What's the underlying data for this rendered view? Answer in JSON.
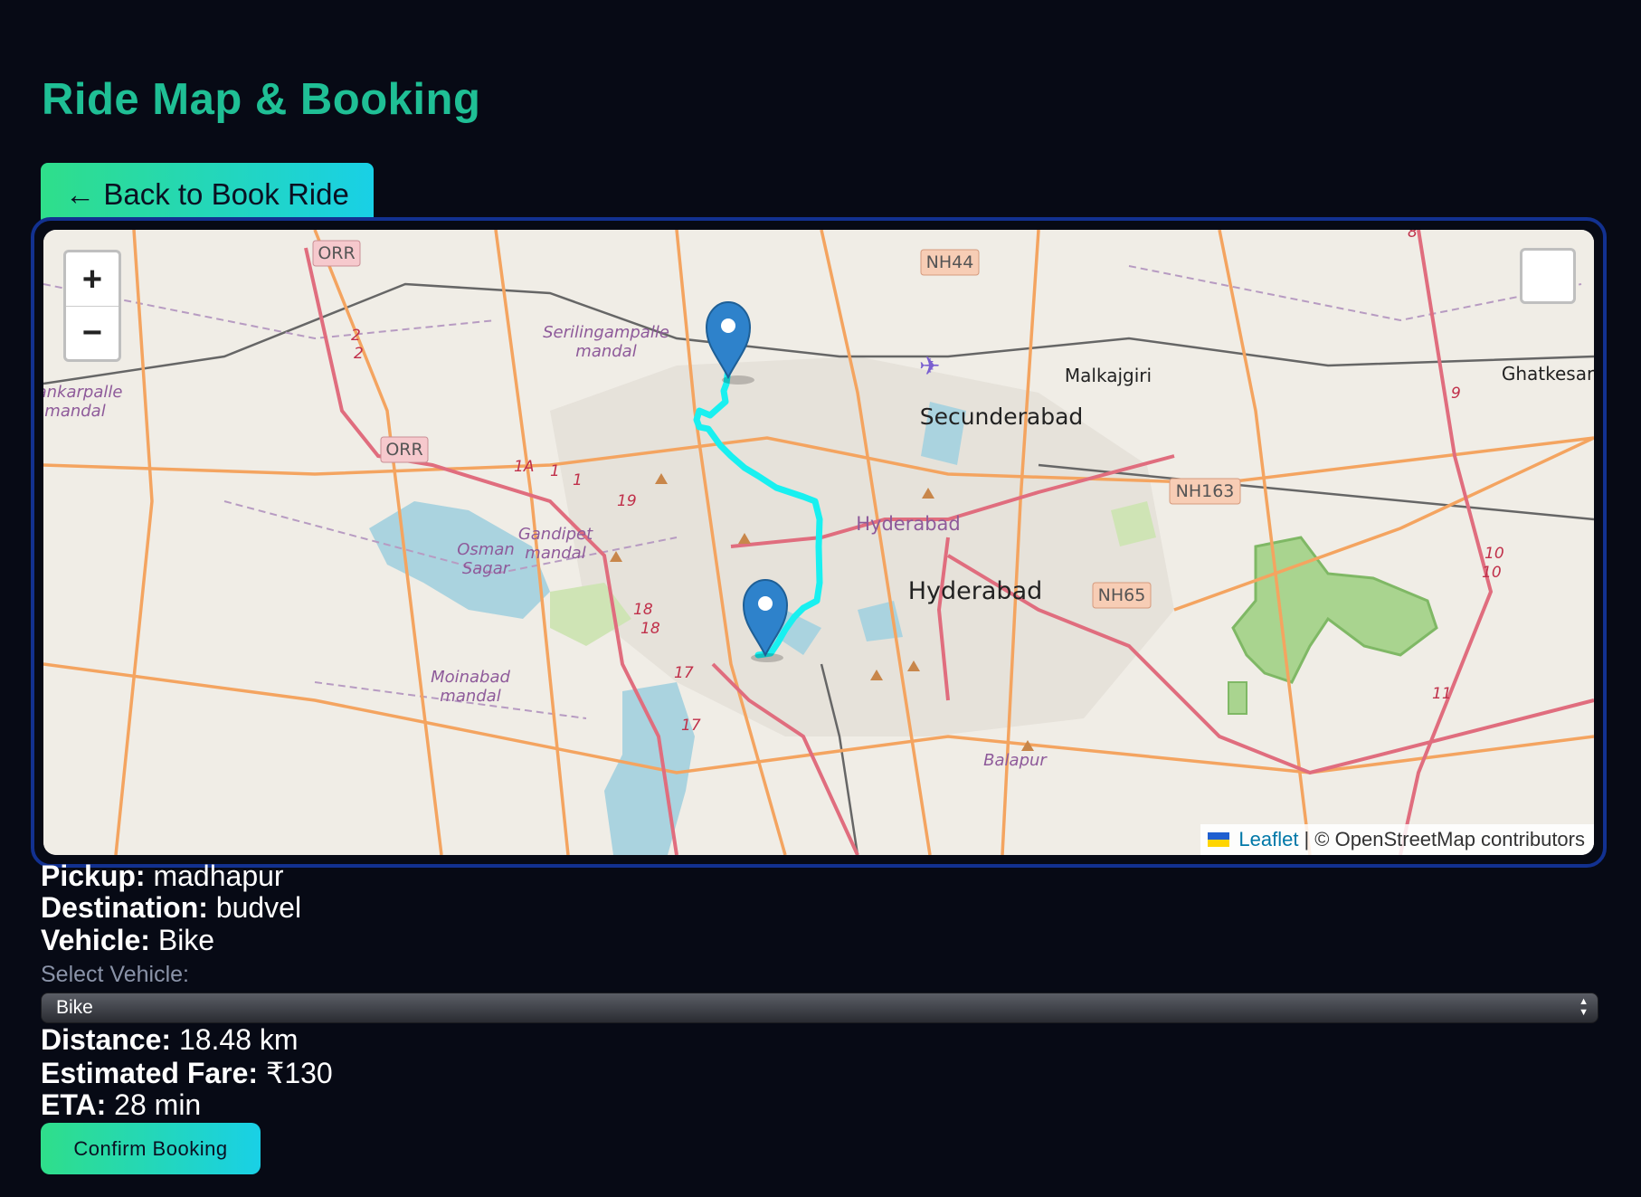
{
  "page": {
    "title": "Ride Map & Booking",
    "back_button_label": "← Back to Book Ride",
    "confirm_button_label": "Confirm Booking"
  },
  "map": {
    "zoom_in_label": "+",
    "zoom_out_label": "−",
    "attribution_link": "Leaflet",
    "attribution_text": "| © OpenStreetMap contributors",
    "route_color": "#19f0f0",
    "marker_color": "#2e82cb",
    "labels": {
      "secunderabad": "Secunderabad",
      "hyderabad_major": "Hyderabad",
      "hyderabad_minor": "Hyderabad",
      "malkajgiri": "Malkajgiri",
      "ghatkesar": "Ghatkesar",
      "serilingampalle_1": "Serilingampalle",
      "serilingampalle_2": "mandal",
      "gandipet_1": "Gandipet",
      "gandipet_2": "mandal",
      "osman_1": "Osman",
      "osman_2": "Sagar",
      "moinabad_1": "Moinabad",
      "moinabad_2": "mandal",
      "shankarpalle_1": "ankarpalle",
      "shankarpalle_2": "mandal",
      "balapur": "Balapur"
    },
    "shields": {
      "orr_1": "ORR",
      "orr_2": "ORR",
      "nh44": "NH44",
      "nh163": "NH163",
      "nh65": "NH65"
    },
    "road_numbers": {
      "r2a": "2",
      "r2b": "2",
      "r1a": "1A",
      "r1b": "1",
      "r1c": "1",
      "r19": "19",
      "r18a": "18",
      "r18b": "18",
      "r17a": "17",
      "r17b": "17",
      "r10a": "10",
      "r10b": "10",
      "r11": "11",
      "r9": "9",
      "r8": "8"
    }
  },
  "details": {
    "pickup_label": "Pickup:",
    "pickup_value": "madhapur",
    "destination_label": "Destination:",
    "destination_value": "budvel",
    "vehicle_label": "Vehicle:",
    "vehicle_value": "Bike",
    "select_label": "Select Vehicle:",
    "select_value": "Bike",
    "distance_label": "Distance:",
    "distance_value": "18.48 km",
    "fare_label": "Estimated Fare:",
    "fare_value": "₹130",
    "eta_label": "ETA:",
    "eta_value": "28 min"
  }
}
